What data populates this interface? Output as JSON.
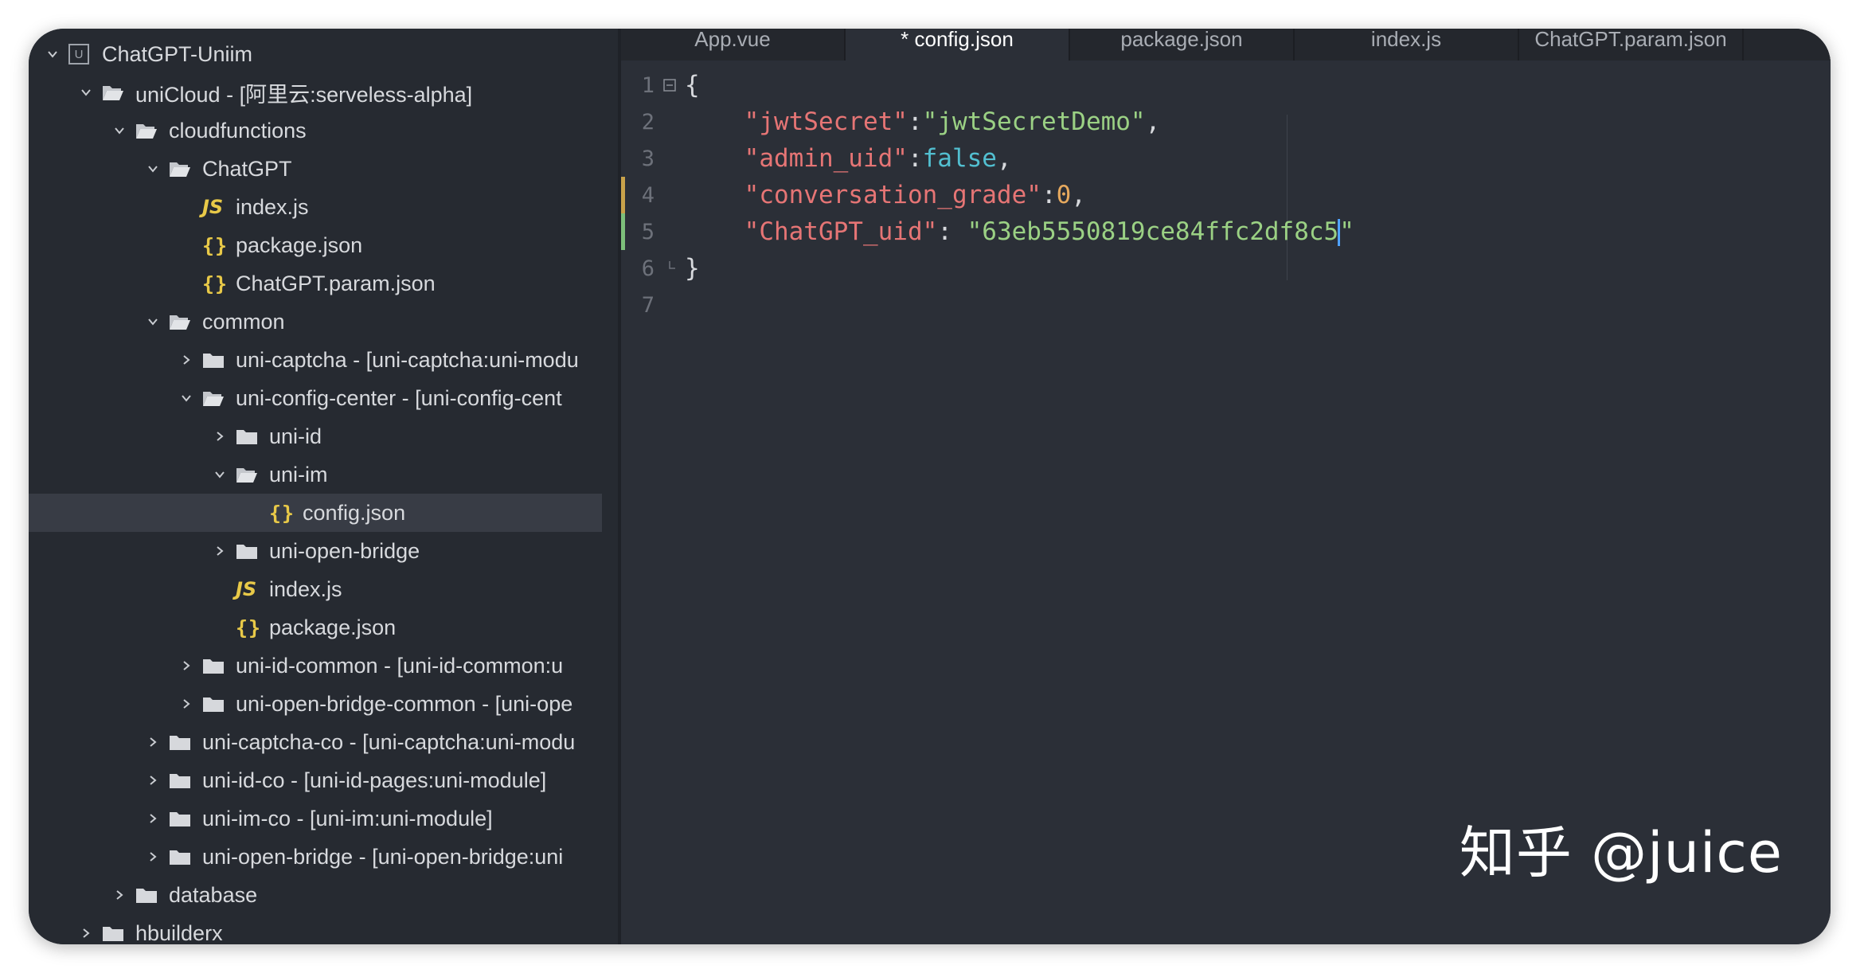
{
  "colors": {
    "sidebar_bg": "#262a31",
    "editor_bg": "#2b2f37",
    "selected_row": "#383c45",
    "json_key": "#e67575",
    "json_string": "#9bd184",
    "json_bool": "#52bfd0",
    "json_number": "#e6a95e",
    "icon_accent": "#e8c948",
    "modified_gutter": "#c8a24a",
    "added_gutter": "#7dbf7a",
    "cursor": "#4fa3ff"
  },
  "tree": [
    {
      "label": "ChatGPT-Uniim",
      "depth": 0,
      "chevron": "down",
      "icon": "project-icon",
      "selected": false
    },
    {
      "label": "uniCloud - [阿里云:serveless-alpha]",
      "depth": 1,
      "chevron": "down",
      "icon": "folder-open-icon",
      "selected": false
    },
    {
      "label": "cloudfunctions",
      "depth": 2,
      "chevron": "down",
      "icon": "folder-open-icon",
      "selected": false
    },
    {
      "label": "ChatGPT",
      "depth": 3,
      "chevron": "down",
      "icon": "folder-open-icon",
      "selected": false
    },
    {
      "label": "index.js",
      "depth": 4,
      "chevron": "none",
      "icon": "js-file-icon",
      "selected": false
    },
    {
      "label": "package.json",
      "depth": 4,
      "chevron": "none",
      "icon": "json-file-icon",
      "selected": false
    },
    {
      "label": "ChatGPT.param.json",
      "depth": 4,
      "chevron": "none",
      "icon": "json-file-icon",
      "selected": false
    },
    {
      "label": "common",
      "depth": 3,
      "chevron": "down",
      "icon": "folder-open-icon",
      "selected": false
    },
    {
      "label": "uni-captcha - [uni-captcha:uni-modu",
      "depth": 4,
      "chevron": "right",
      "icon": "folder-icon",
      "selected": false
    },
    {
      "label": "uni-config-center - [uni-config-cent",
      "depth": 4,
      "chevron": "down",
      "icon": "folder-open-icon",
      "selected": false
    },
    {
      "label": "uni-id",
      "depth": 5,
      "chevron": "right",
      "icon": "folder-icon",
      "selected": false
    },
    {
      "label": "uni-im",
      "depth": 5,
      "chevron": "down",
      "icon": "folder-open-icon",
      "selected": false
    },
    {
      "label": "config.json",
      "depth": 6,
      "chevron": "none",
      "icon": "json-file-icon",
      "selected": true
    },
    {
      "label": "uni-open-bridge",
      "depth": 5,
      "chevron": "right",
      "icon": "folder-icon",
      "selected": false
    },
    {
      "label": "index.js",
      "depth": 5,
      "chevron": "none",
      "icon": "js-file-icon",
      "selected": false
    },
    {
      "label": "package.json",
      "depth": 5,
      "chevron": "none",
      "icon": "json-file-icon",
      "selected": false
    },
    {
      "label": "uni-id-common - [uni-id-common:u",
      "depth": 4,
      "chevron": "right",
      "icon": "folder-icon",
      "selected": false
    },
    {
      "label": "uni-open-bridge-common - [uni-ope",
      "depth": 4,
      "chevron": "right",
      "icon": "folder-icon",
      "selected": false
    },
    {
      "label": "uni-captcha-co - [uni-captcha:uni-modu",
      "depth": 3,
      "chevron": "right",
      "icon": "folder-icon",
      "selected": false
    },
    {
      "label": "uni-id-co - [uni-id-pages:uni-module]",
      "depth": 3,
      "chevron": "right",
      "icon": "folder-icon",
      "selected": false
    },
    {
      "label": "uni-im-co - [uni-im:uni-module]",
      "depth": 3,
      "chevron": "right",
      "icon": "folder-icon",
      "selected": false
    },
    {
      "label": "uni-open-bridge - [uni-open-bridge:uni",
      "depth": 3,
      "chevron": "right",
      "icon": "folder-icon",
      "selected": false
    },
    {
      "label": "database",
      "depth": 2,
      "chevron": "right",
      "icon": "folder-icon",
      "selected": false
    },
    {
      "label": "hbuilderx",
      "depth": 1,
      "chevron": "right",
      "icon": "folder-icon",
      "selected": false
    }
  ],
  "tabs": [
    {
      "label": "App.vue",
      "active": false
    },
    {
      "label": "* config.json",
      "active": true
    },
    {
      "label": "package.json",
      "active": false
    },
    {
      "label": "index.js",
      "active": false
    },
    {
      "label": "ChatGPT.param.json",
      "active": false
    }
  ],
  "code": [
    {
      "num": "1",
      "fold": "open",
      "mark": "none",
      "indent": "",
      "tokens": [
        {
          "t": "punc",
          "v": "{"
        }
      ]
    },
    {
      "num": "2",
      "fold": "none",
      "mark": "none",
      "indent": "    ",
      "tokens": [
        {
          "t": "key",
          "v": "\"jwtSecret\""
        },
        {
          "t": "punc",
          "v": ":"
        },
        {
          "t": "str",
          "v": "\"jwtSecretDemo\""
        },
        {
          "t": "punc",
          "v": ","
        }
      ]
    },
    {
      "num": "3",
      "fold": "none",
      "mark": "none",
      "indent": "    ",
      "tokens": [
        {
          "t": "key",
          "v": "\"admin_uid\""
        },
        {
          "t": "punc",
          "v": ":"
        },
        {
          "t": "bool",
          "v": "false"
        },
        {
          "t": "punc",
          "v": ","
        }
      ]
    },
    {
      "num": "4",
      "fold": "none",
      "mark": "modified",
      "indent": "    ",
      "tokens": [
        {
          "t": "key",
          "v": "\"conversation_grade\""
        },
        {
          "t": "punc",
          "v": ":"
        },
        {
          "t": "num",
          "v": "0"
        },
        {
          "t": "punc",
          "v": ","
        }
      ]
    },
    {
      "num": "5",
      "fold": "none",
      "mark": "added",
      "indent": "    ",
      "tokens": [
        {
          "t": "key",
          "v": "\"ChatGPT_uid\""
        },
        {
          "t": "punc",
          "v": ": "
        },
        {
          "t": "str",
          "v": "\"63eb5550819ce84ffc2df8c5"
        },
        {
          "t": "cursor",
          "v": ""
        },
        {
          "t": "str",
          "v": "\""
        }
      ]
    },
    {
      "num": "6",
      "fold": "end",
      "mark": "none",
      "indent": "",
      "tokens": [
        {
          "t": "punc",
          "v": "}"
        }
      ]
    },
    {
      "num": "7",
      "fold": "none",
      "mark": "none",
      "indent": "",
      "tokens": []
    }
  ],
  "watermark": "知乎 @juice"
}
